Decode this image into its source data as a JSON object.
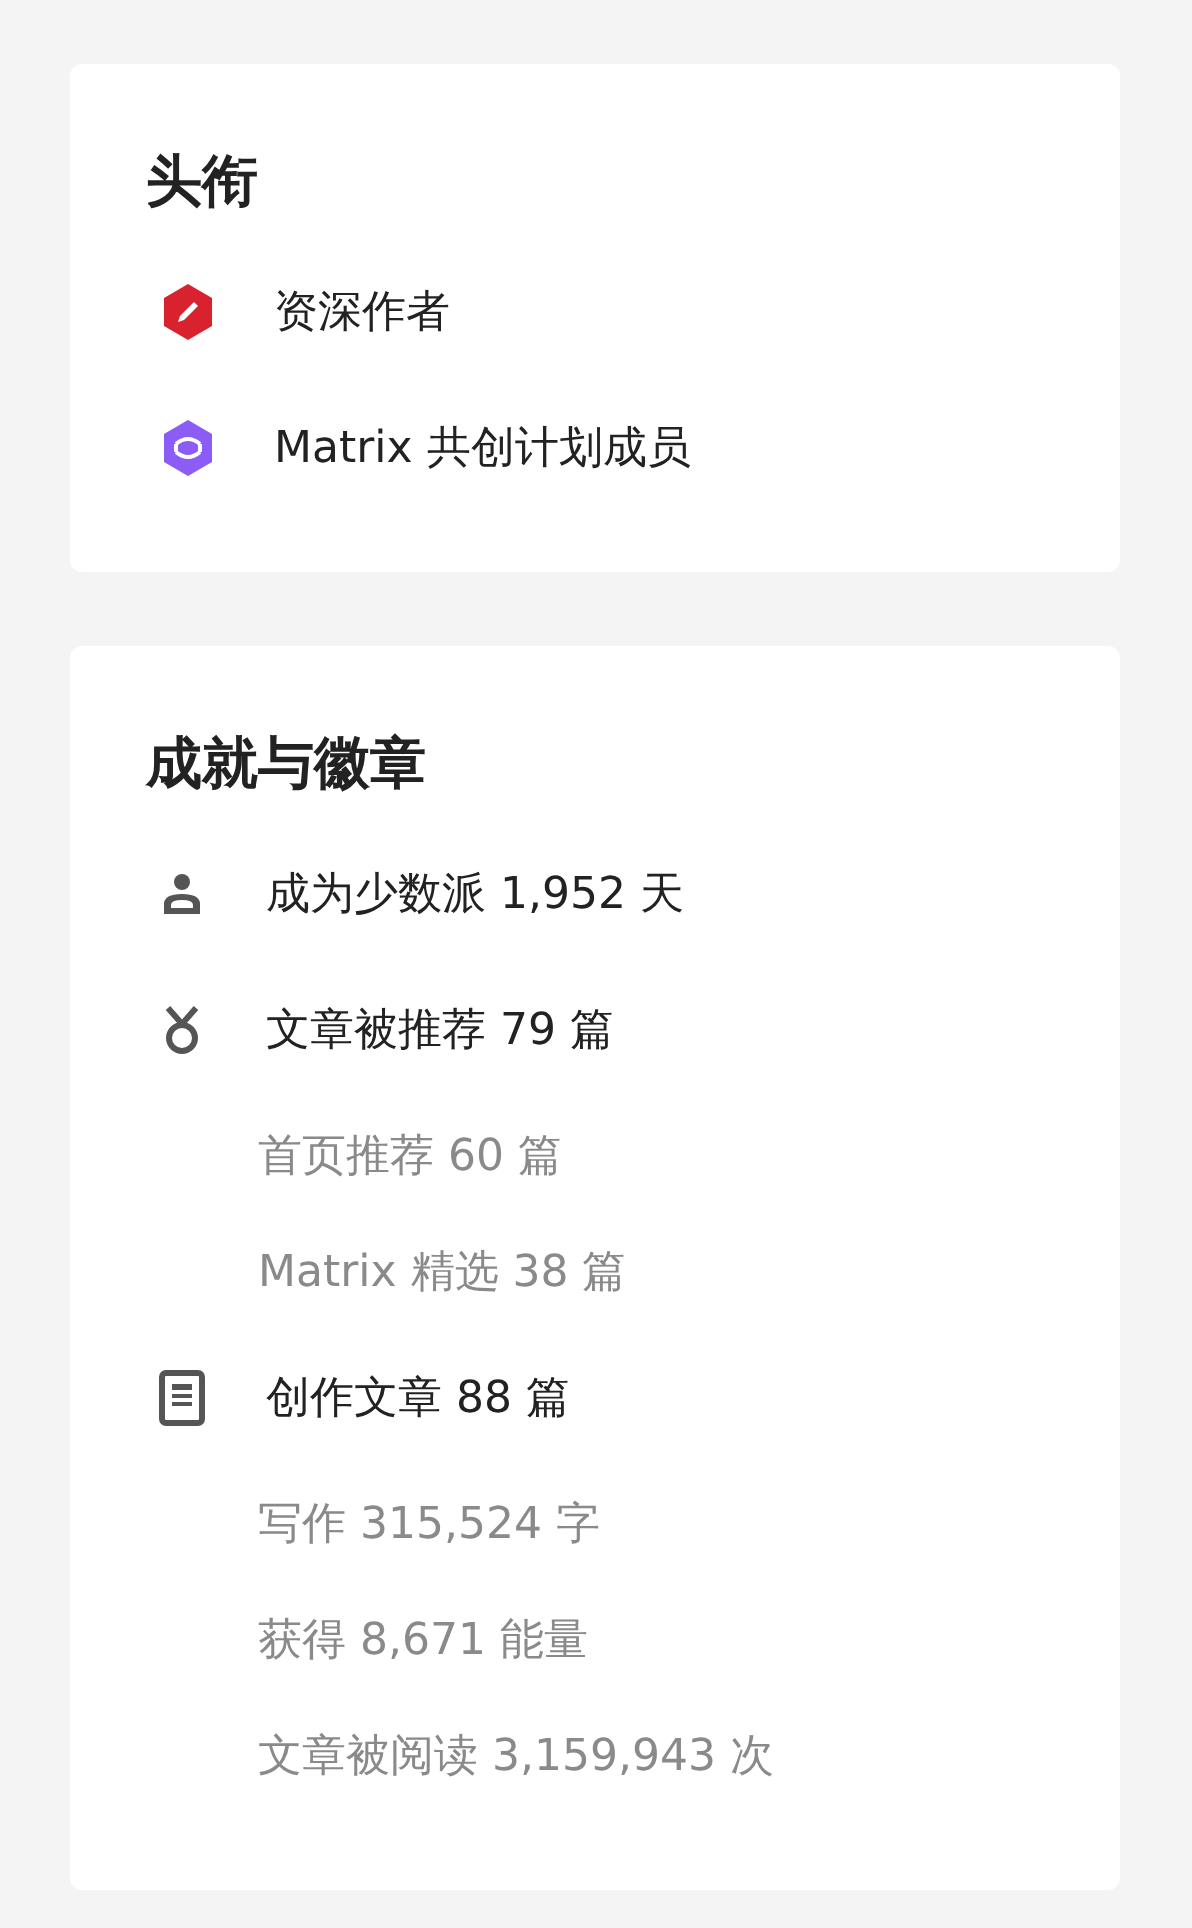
{
  "titles_card": {
    "heading": "头衔",
    "items": [
      {
        "kind": "pen",
        "label": "资深作者"
      },
      {
        "kind": "matrix",
        "label": "Matrix 共创计划成员"
      }
    ]
  },
  "achievements_card": {
    "heading": "成就与徽章",
    "items": [
      {
        "kind": "person",
        "label": "成为少数派 1,952 天"
      },
      {
        "kind": "medal",
        "label": "文章被推荐 79 篇",
        "children": [
          {
            "label": "首页推荐 60 篇"
          },
          {
            "label": "Matrix 精选 38 篇"
          }
        ]
      },
      {
        "kind": "document",
        "label": "创作文章 88 篇",
        "children": [
          {
            "label": "写作 315,524 字"
          },
          {
            "label": "获得 8,671 能量"
          },
          {
            "label": "文章被阅读 3,159,943 次"
          }
        ]
      }
    ]
  }
}
